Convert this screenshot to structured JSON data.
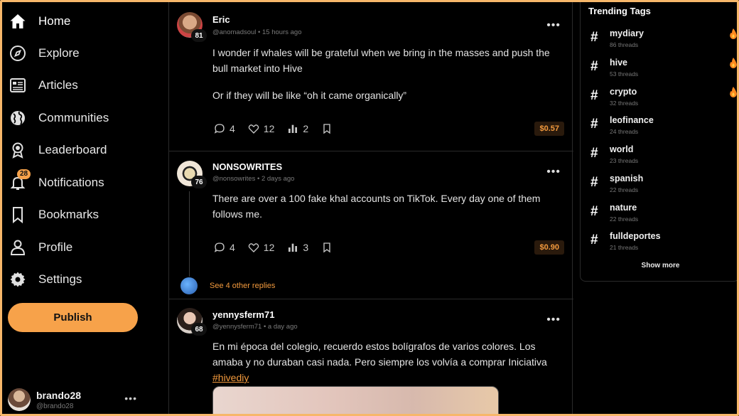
{
  "sidebar": {
    "items": [
      {
        "label": "Home",
        "icon": "home-icon"
      },
      {
        "label": "Explore",
        "icon": "compass-icon"
      },
      {
        "label": "Articles",
        "icon": "newspaper-icon"
      },
      {
        "label": "Communities",
        "icon": "globe-icon"
      },
      {
        "label": "Leaderboard",
        "icon": "award-icon"
      },
      {
        "label": "Notifications",
        "icon": "bell-icon",
        "badge": "28"
      },
      {
        "label": "Bookmarks",
        "icon": "bookmark-icon"
      },
      {
        "label": "Profile",
        "icon": "user-icon"
      },
      {
        "label": "Settings",
        "icon": "gear-icon"
      }
    ],
    "publish_label": "Publish",
    "account": {
      "name": "brando28",
      "handle": "@brando28",
      "more": "•••"
    }
  },
  "feed": {
    "posts": [
      {
        "author": "Eric",
        "handle": "@anomadsoul",
        "time": "15 hours ago",
        "reputation": "81",
        "paragraphs": [
          "I wonder if whales will be grateful when we bring in the masses and push the bull market into Hive",
          "Or if they will be like “oh it came organically”"
        ],
        "comments": "4",
        "likes": "12",
        "votes": "2",
        "payout": "$0.57",
        "more": "•••"
      },
      {
        "author": "NONSOWRITES",
        "handle": "@nonsowrites",
        "time": "2 days ago",
        "reputation": "76",
        "paragraphs": [
          "There are over a 100 fake khal accounts on TikTok. Every day one of them follows me."
        ],
        "comments": "4",
        "likes": "12",
        "votes": "3",
        "payout": "$0.90",
        "more": "•••",
        "replies_link": "See 4 other replies"
      },
      {
        "author": "yennysferm71",
        "handle": "@yennysferm71",
        "time": "a day ago",
        "reputation": "68",
        "paragraphs": [
          "En mi época del colegio, recuerdo estos bolígrafos de varios colores. Los amaba y no duraban casi nada. Pero siempre los volvía a comprar Iniciativa"
        ],
        "hashtag": "#hivediy",
        "more": "•••"
      }
    ]
  },
  "trending": {
    "title": "Trending Tags",
    "tags": [
      {
        "name": "mydiary",
        "count": "86 threads",
        "hot": true
      },
      {
        "name": "hive",
        "count": "53 threads",
        "hot": true
      },
      {
        "name": "crypto",
        "count": "32 threads",
        "hot": true
      },
      {
        "name": "leofinance",
        "count": "24 threads",
        "hot": false
      },
      {
        "name": "world",
        "count": "23 threads",
        "hot": false
      },
      {
        "name": "spanish",
        "count": "22 threads",
        "hot": false
      },
      {
        "name": "nature",
        "count": "22 threads",
        "hot": false
      },
      {
        "name": "fulldeportes",
        "count": "21 threads",
        "hot": false
      }
    ],
    "show_more": "Show more"
  },
  "colors": {
    "accent": "#f7a24a",
    "background": "#000000",
    "payout_text": "#f39a3d"
  }
}
